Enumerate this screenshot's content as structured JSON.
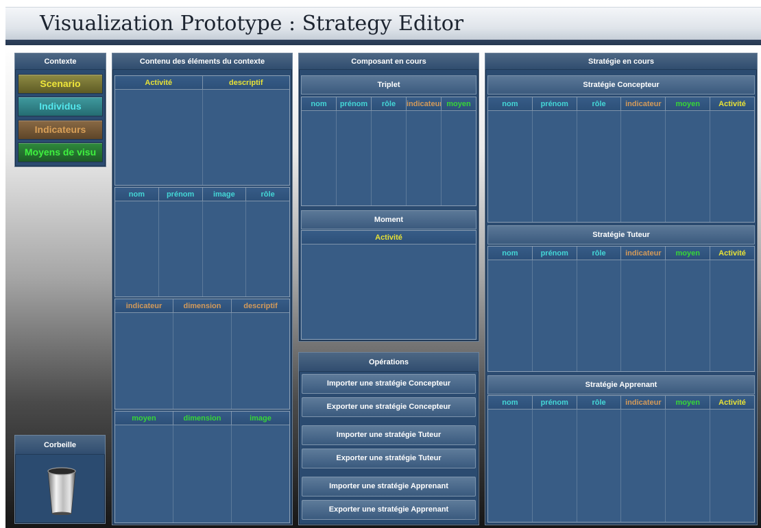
{
  "window": {
    "title": "Visualization Prototype : Strategy Editor"
  },
  "contexte": {
    "title": "Contexte",
    "buttons": [
      "Scenario",
      "Individus",
      "Indicateurs",
      "Moyens de visu"
    ]
  },
  "corbeille": {
    "title": "Corbeille",
    "icon": "trash-can-icon"
  },
  "contenu": {
    "title": "Contenu des éléments du contexte",
    "tables": [
      [
        "Activité",
        "descriptif"
      ],
      [
        "nom",
        "prénom",
        "image",
        "rôle"
      ],
      [
        "indicateur",
        "dimension",
        "descriptif"
      ],
      [
        "moyen",
        "dimension",
        "image"
      ]
    ]
  },
  "composant": {
    "title": "Composant en cours",
    "triplet": {
      "title": "Triplet",
      "columns": [
        "nom",
        "prénom",
        "rôle",
        "indicateur",
        "moyen"
      ]
    },
    "moment": {
      "title": "Moment",
      "columns": [
        "Activité"
      ]
    }
  },
  "operations": {
    "title": "Opérations",
    "buttons": [
      "Importer une stratégie Concepteur",
      "Exporter une stratégie Concepteur",
      "Importer une stratégie Tuteur",
      "Exporter une stratégie Tuteur",
      "Importer une stratégie Apprenant",
      "Exporter une stratégie Apprenant"
    ]
  },
  "strategie": {
    "title": "Stratégie en cours",
    "columns": [
      "nom",
      "prénom",
      "rôle",
      "indicateur",
      "moyen",
      "Activité"
    ],
    "sections": [
      "Stratégie Concepteur",
      "Stratégie Tuteur",
      "Stratégie Apprenant"
    ]
  },
  "colors": {
    "panel": "#2b4b70",
    "scenario": "#efe63a",
    "individus": "#54e8ee",
    "indicateurs": "#d9a058",
    "moyens": "#3ff03f"
  }
}
